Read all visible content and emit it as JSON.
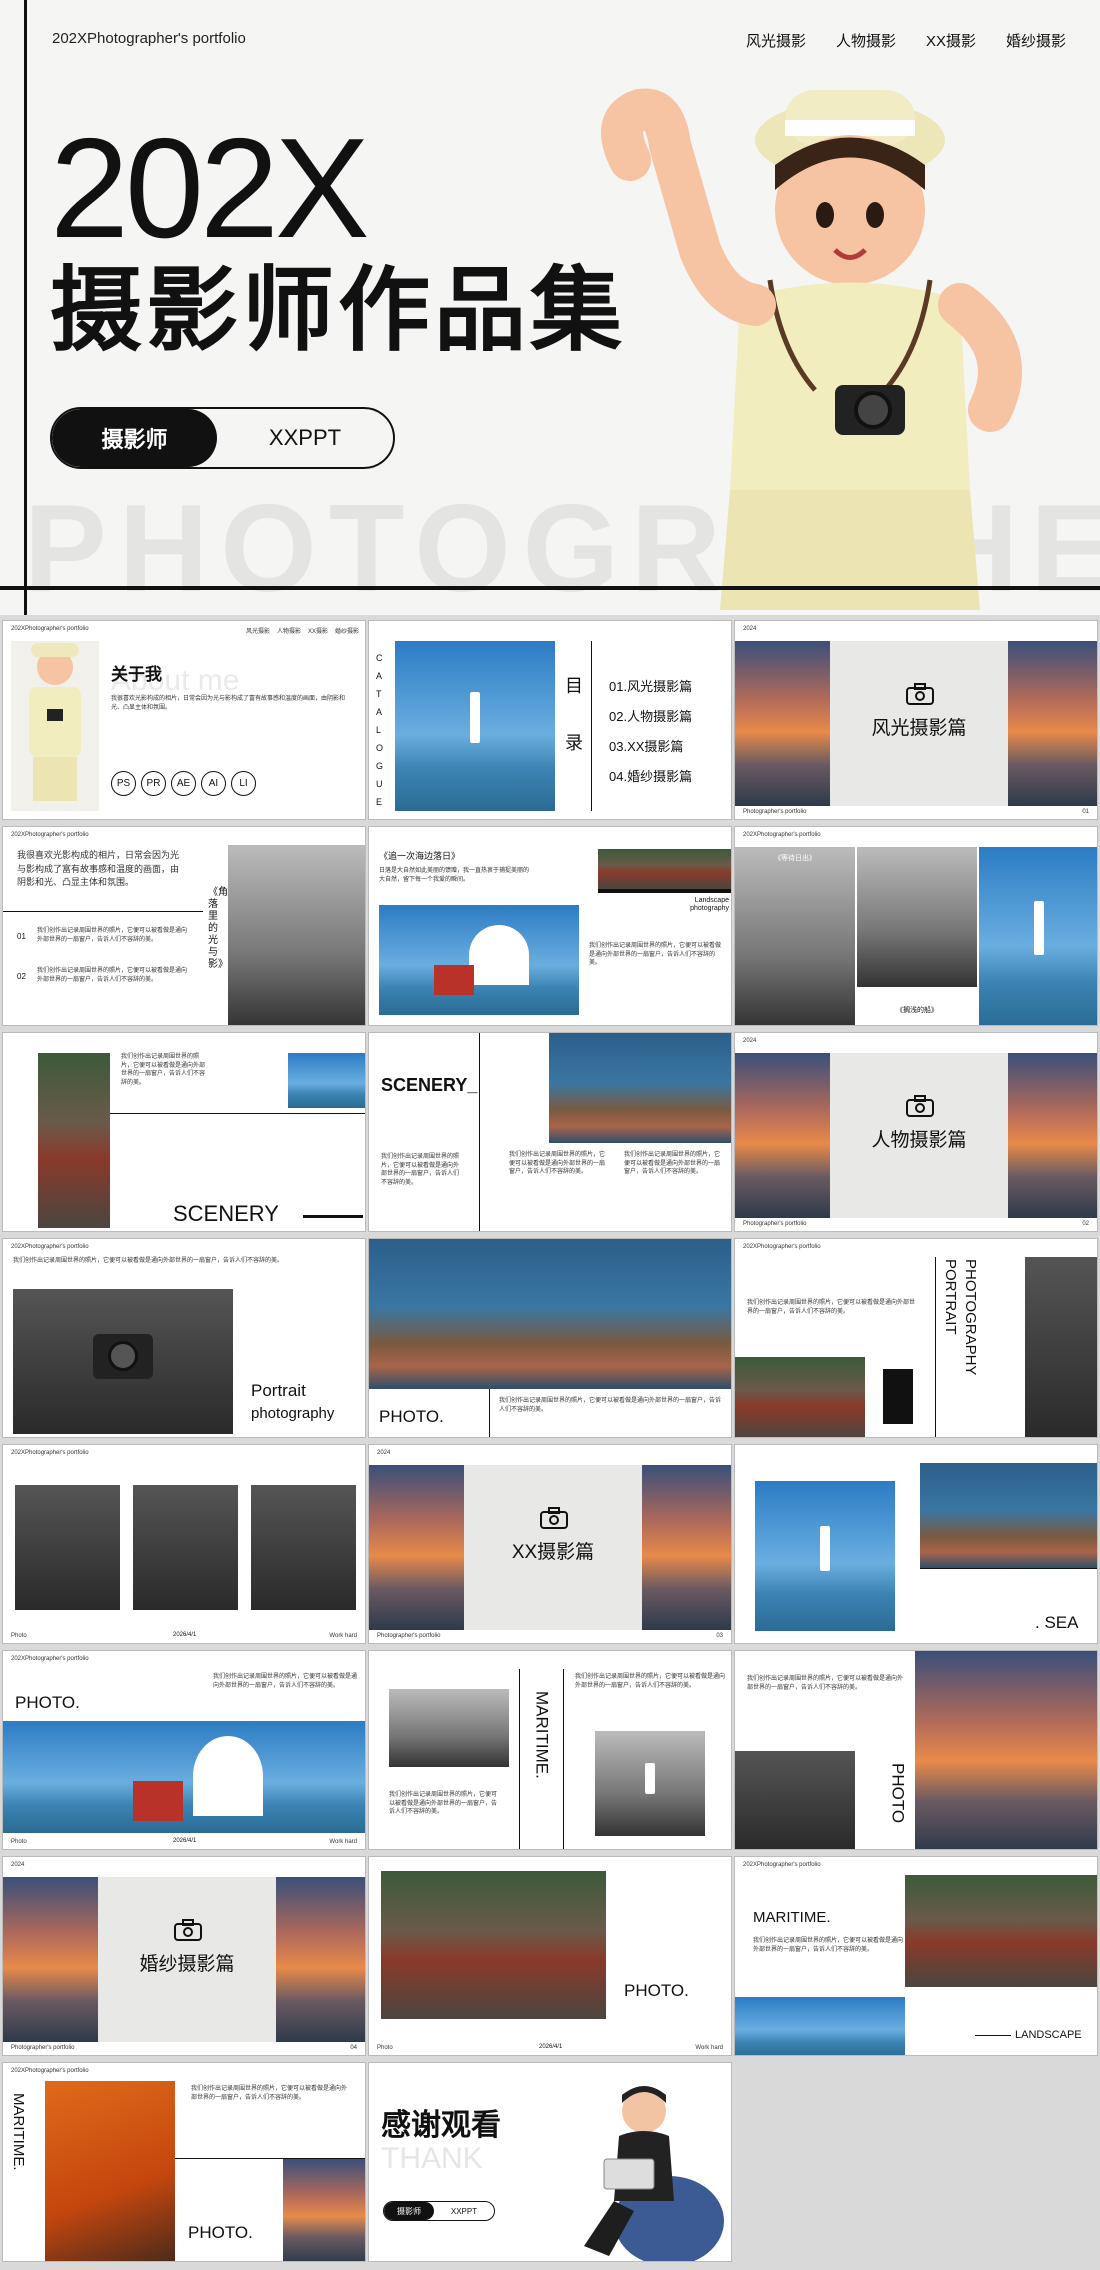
{
  "hero": {
    "brand": "202XPhotographer's portfolio",
    "nav": [
      "风光摄影",
      "人物摄影",
      "XX摄影",
      "婚纱摄影"
    ],
    "year": "202X",
    "title": "摄影师作品集",
    "pill_left": "摄影师",
    "pill_right": "XXPPT",
    "watermark": "PHOTOGRAPHER"
  },
  "common": {
    "header": "202XPhotographer's portfolio",
    "nav": [
      "风光摄影",
      "人物摄影",
      "XX摄影",
      "婚纱摄影"
    ],
    "footer": "Photographer's portfolio",
    "year": "2024",
    "photo_label": "Photo",
    "date": "2026/4/1",
    "work_hard": "Work hard"
  },
  "s1": {
    "title": "关于我",
    "ghost": "About me",
    "body": "我很喜欢光影构成的相片，日常会因为光与影构成了富有故事感和温度的画面，由阴影和光、凸显主体和氛围。",
    "tags": [
      "PS",
      "PR",
      "AE",
      "AI",
      "LI"
    ]
  },
  "s2": {
    "vertical": "CATALOGUE",
    "mu": "目",
    "lu": "录",
    "items": [
      "01.风光摄影篇",
      "02.人物摄影篇",
      "03.XX摄影篇",
      "04.婚纱摄影篇"
    ]
  },
  "s3": {
    "title": "风光摄影篇",
    "num": "01"
  },
  "s4": {
    "quote": "我很喜欢光影构成的相片，日常会因为光与影构成了富有故事感和温度的画面，由阴影和光、凸显主体和氛围。",
    "vert": "《角落里的光与影》",
    "n1": "01",
    "n2": "02"
  },
  "s5": {
    "quote": "《追一次海边落日》",
    "sub": "日落是大自然如此美丽的馈赠，我一直热衷于捕捉美丽的大自然，留下每一个我爱的瞬间。",
    "landscape": "Landscape photography"
  },
  "s6": {
    "cap1": "《等待日出》",
    "cap2": "《搁浅的船》"
  },
  "s7": {
    "title": "SCENERY"
  },
  "s8": {
    "title": "SCENERY_"
  },
  "s9": {
    "title": "人物摄影篇",
    "num": "02"
  },
  "s10": {
    "title": "Portrait",
    "sub": "photography"
  },
  "s11": {
    "title": "PHOTO."
  },
  "s12": {
    "v1": "PORTRAIT",
    "v2": "PHOTOGRAPHY"
  },
  "s14": {
    "title": "XX摄影篇",
    "num": "03"
  },
  "s15": {
    "title": ". SEA"
  },
  "s16": {
    "title": "PHOTO."
  },
  "s17": {
    "title": "MARITIME."
  },
  "s18": {
    "title": "PHOTO"
  },
  "s19": {
    "title": "婚纱摄影篇",
    "num": "04"
  },
  "s20": {
    "title": "PHOTO."
  },
  "s21": {
    "title": "MARITIME.",
    "landscape": "LANDSCAPE"
  },
  "s22": {
    "vert": "MARITIME.",
    "title": "PHOTO."
  },
  "s23": {
    "title": "感谢观看",
    "ghost": "THANK",
    "pill_left": "摄影师",
    "pill_right": "XXPPT"
  },
  "body_text": "我们创作出记录周围世界的照片，它便可以被看做是通向外部世界的一扇窗户，告诉人们不容辞的美。"
}
